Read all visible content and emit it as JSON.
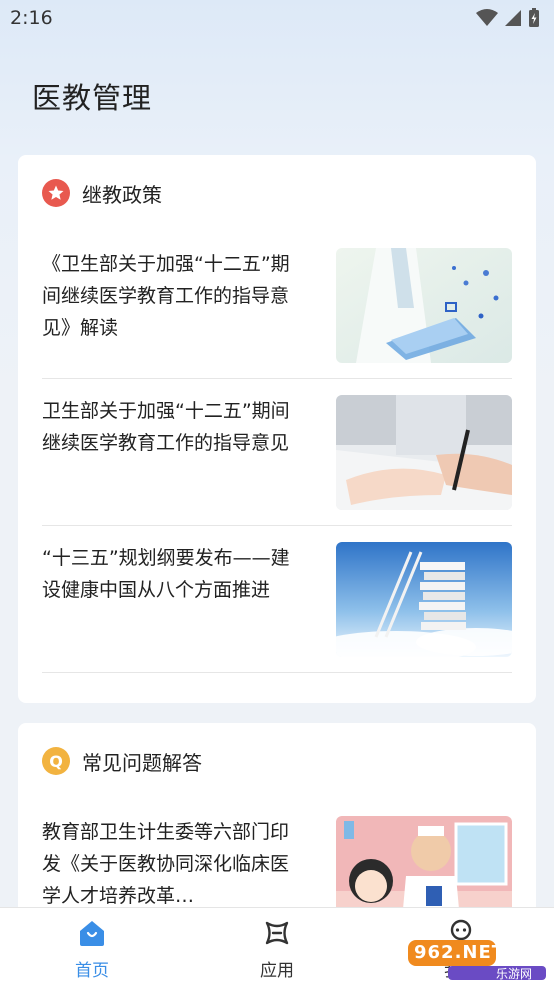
{
  "status_bar": {
    "time": "2:16"
  },
  "page_title": "医教管理",
  "sections": [
    {
      "title": "继教政策",
      "icon": "star-icon",
      "items": [
        {
          "title": "《卫生部关于加强“十二五”期间继续医学教育工作的指导意见》解读"
        },
        {
          "title": "卫生部关于加强“十二五”期间继续医学教育工作的指导意见"
        },
        {
          "title": "“十三五”规划纲要发布——建设健康中国从八个方面推进"
        }
      ]
    },
    {
      "title": "常见问题解答",
      "icon": "q-icon",
      "icon_letter": "Q",
      "items": [
        {
          "title": "教育部卫生计生委等六部门印发《关于医教协同深化临床医学人才培养改革…"
        }
      ]
    }
  ],
  "bottom_nav": [
    {
      "label": "首页",
      "icon": "home-icon",
      "active": true
    },
    {
      "label": "应用",
      "icon": "apps-icon",
      "active": false
    },
    {
      "label": "我的",
      "icon": "profile-icon",
      "active": false
    }
  ],
  "watermark": {
    "brand": "962.NET",
    "sub": "乐游网"
  },
  "colors": {
    "accent": "#3a8ee6",
    "badge_red": "#e8594f",
    "badge_orange": "#f2b340"
  }
}
